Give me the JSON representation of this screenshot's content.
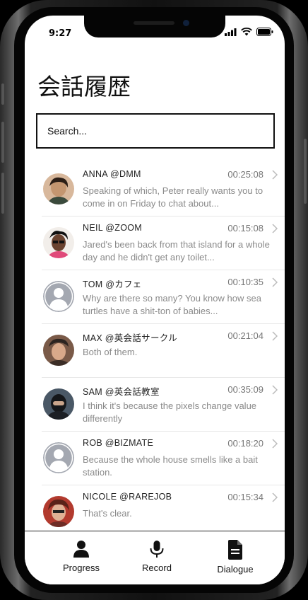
{
  "status": {
    "time": "9:27"
  },
  "page": {
    "title": "会話履歴"
  },
  "search": {
    "placeholder": "Search..."
  },
  "chats": [
    {
      "name": "ANNA  @DMM",
      "time": "00:25:08",
      "preview": "Speaking of which, Peter really wants you to come in on Friday to chat about...",
      "avatar": "photo"
    },
    {
      "name": "NEIL  @ZOOM",
      "time": "00:15:08",
      "preview": "Jared's been back from that island for a whole day and he didn't get any toilet...",
      "avatar": "photo"
    },
    {
      "name": "TOM  @カフェ",
      "time": "00:10:35",
      "preview": "Why are there so many? You know how sea turtles have a shit-ton of babies...",
      "avatar": "placeholder-person-icon"
    },
    {
      "name": "MAX @英会話サークル",
      "time": "00:21:04",
      "preview": "Both of them.",
      "avatar": "photo"
    },
    {
      "name": "SAM @英会話教室",
      "time": "00:35:09",
      "preview": "I think it's because the pixels change value differently",
      "avatar": "photo"
    },
    {
      "name": "ROB @BIZMATE",
      "time": "00:18:20",
      "preview": "Because the whole house smells like a bait station.",
      "avatar": "placeholder-person-icon"
    },
    {
      "name": "NICOLE @RAREJOB",
      "time": "00:15:34",
      "preview": "That's clear.",
      "avatar": "photo"
    }
  ],
  "tabs": [
    {
      "label": "Progress",
      "icon": "person-icon"
    },
    {
      "label": "Record",
      "icon": "microphone-icon"
    },
    {
      "label": "Dialogue",
      "icon": "document-icon"
    }
  ]
}
